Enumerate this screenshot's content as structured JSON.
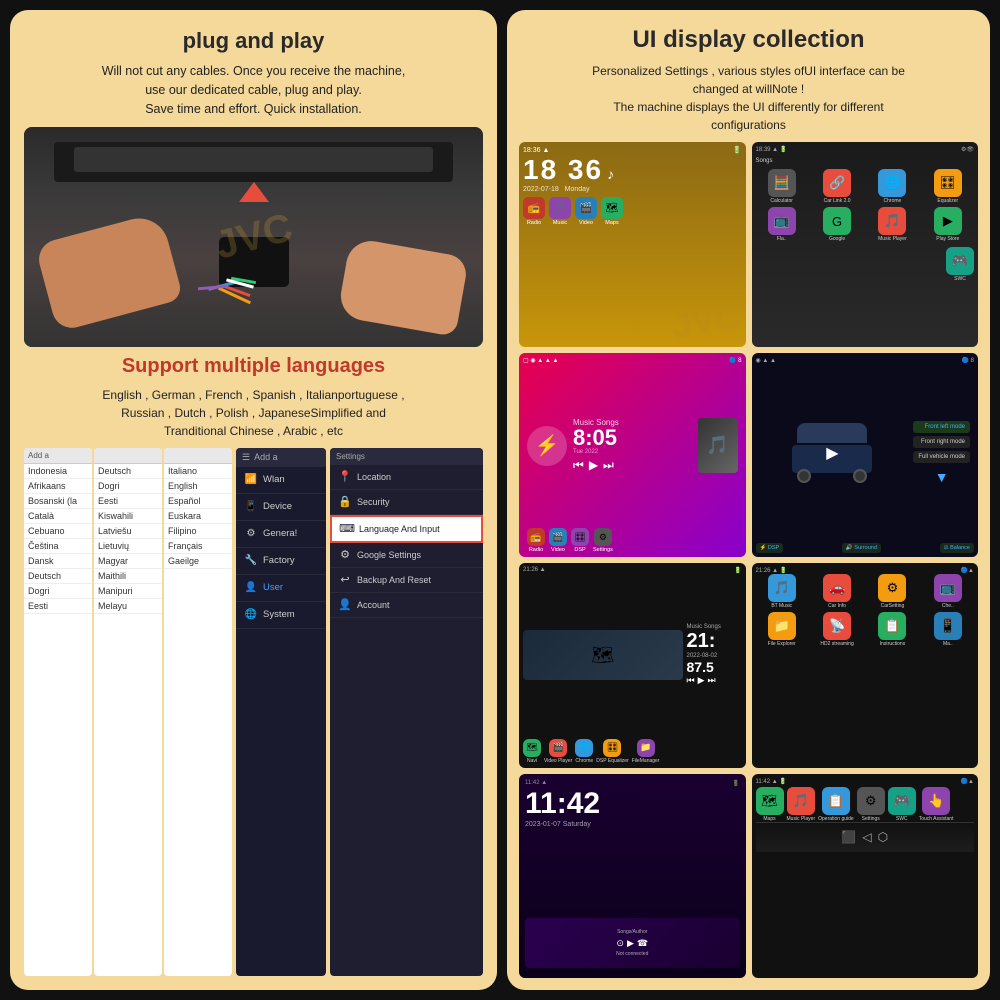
{
  "left_panel": {
    "plug_title": "plug and play",
    "plug_desc": "Will not cut any cables. Once you receive the machine,\nuse our dedicated cable, plug and play.\nSave time and effort. Quick installation.",
    "multilang_title": "Support multiple languages",
    "multilang_desc": "English , German , French , Spanish , Italianportuguese ,\nRussian , Dutch , Polish , JapaneseSimplified and\nTranditional Chinese , Arabic , etc",
    "lang_columns": {
      "col1_header": "Add a",
      "col1_items": [
        "Indonesia",
        "Afrikaans",
        "Bosanski (la",
        "Català",
        "Cebuano",
        "Čeština",
        "Dansk",
        "Deutsch",
        "Dogri",
        "Eesti"
      ],
      "col2_items": [
        "Deutsch",
        "Dogri",
        "Eesti",
        "Kiswahili",
        "Latviešu",
        "Lietuvių",
        "Magyar",
        "Maithili",
        "Manipuri",
        "Melayu"
      ],
      "col3_items": [
        "Italiano",
        "English",
        "Español",
        "Euskara",
        "Filipino",
        "Français",
        "Gaeilge"
      ]
    },
    "settings_menu": {
      "header": "Add a",
      "items": [
        {
          "icon": "wifi",
          "label": "Wlan"
        },
        {
          "icon": "device",
          "label": "Device"
        },
        {
          "icon": "gear",
          "label": "Genera!"
        },
        {
          "icon": "wrench",
          "label": "Factory"
        },
        {
          "icon": "user",
          "label": "User",
          "active": true
        },
        {
          "icon": "globe",
          "label": "System"
        }
      ]
    },
    "settings_right": {
      "items": [
        {
          "icon": "📍",
          "label": "Location"
        },
        {
          "icon": "🔒",
          "label": "Security"
        },
        {
          "icon": "⌨",
          "label": "Languaqe And Input",
          "highlighted": true
        },
        {
          "icon": "⚙",
          "label": "Google Settings"
        },
        {
          "icon": "↩",
          "label": "Backup And Reset"
        },
        {
          "icon": "👤",
          "label": "Account"
        }
      ]
    }
  },
  "right_panel": {
    "title": "UI display collection",
    "desc": "Personalized Settings , various styles ofUI interface can be\nchanged at willNote !\nThe machine displays the UI differently for different\nconfigurations",
    "screens": [
      {
        "id": 1,
        "type": "clock_home",
        "time": "18 36",
        "date": "2022-07-18  Monday",
        "apps": [
          "Radio",
          "Music",
          "Video",
          "Maps"
        ]
      },
      {
        "id": 2,
        "type": "app_grid",
        "time": "18:39",
        "apps": [
          "Calculator",
          "Car Link 2.0",
          "Chrome",
          "Equalizer",
          "Fla..",
          "Google",
          "Music Player",
          "Play Store",
          "SWC"
        ]
      },
      {
        "id": 3,
        "type": "bluetooth_media",
        "bt_time": "8:05",
        "bt_date": "Tue 2022"
      },
      {
        "id": 4,
        "type": "dsp_car",
        "modes": [
          "Front left mode",
          "Front right mode",
          "Full vehicle mode"
        ],
        "bottom": [
          "DSP",
          "Surround",
          "Balance"
        ]
      },
      {
        "id": 5,
        "type": "nav_music",
        "time": "21:",
        "speed": "87.5",
        "apps": [
          "Navi",
          "Video Player",
          "Chrome",
          "DSP Equalizer",
          "FileManager"
        ]
      },
      {
        "id": 6,
        "type": "app_grid_2",
        "time": "21:26",
        "apps": [
          "BT Music",
          "Car Info",
          "CarSetting",
          "Che..",
          "File Explorer",
          "HD2 streaming",
          "Instructions",
          "Ma.."
        ]
      },
      {
        "id": 7,
        "type": "clock_dark",
        "time": "11:42",
        "date": "2023-01-07  Saturday",
        "apps": [
          "Songs/Author",
          "Not connected"
        ]
      },
      {
        "id": 8,
        "type": "settings_apps",
        "time": "11:42",
        "apps": [
          "Maps",
          "Music Player",
          "Operation guide",
          "Settings",
          "SWC",
          "Touch Assistant"
        ]
      }
    ]
  }
}
